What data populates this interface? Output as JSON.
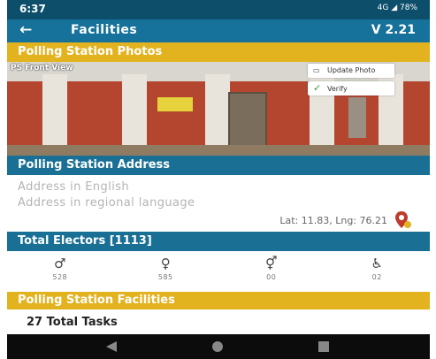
{
  "status_bar": {
    "time": "6:37",
    "indicators": "4G ◢ 78%"
  },
  "app_bar": {
    "back_icon": "←",
    "title": "Facilities",
    "version": "V 2.21"
  },
  "photos_section": {
    "title": "Polling Station Photos",
    "photo_label": "PS Front View",
    "update_photo_label": "Update Photo",
    "verify_label": "Verify"
  },
  "address_section": {
    "title": "Polling Station Address",
    "english_placeholder": "Address in English",
    "regional_placeholder": "Address in regional language",
    "latlng": "Lat: 11.83, Lng: 76.21"
  },
  "electors_section": {
    "title": "Total Electors [1113]",
    "stats": [
      {
        "icon": "male-icon",
        "glyph": "♂",
        "value": "528"
      },
      {
        "icon": "female-icon",
        "glyph": "♀",
        "value": "585"
      },
      {
        "icon": "third-gender-icon",
        "glyph": "⚥",
        "value": "00"
      },
      {
        "icon": "wheelchair-icon",
        "glyph": "♿",
        "value": "02"
      }
    ]
  },
  "facilities_section": {
    "title": "Polling Station Facilities",
    "tasks_label": "27 Total Tasks"
  },
  "colors": {
    "status_bar": "#0d4f6b",
    "app_bar": "#16729a",
    "section_yellow": "#e3b21f",
    "section_blue": "#1a6f95"
  }
}
